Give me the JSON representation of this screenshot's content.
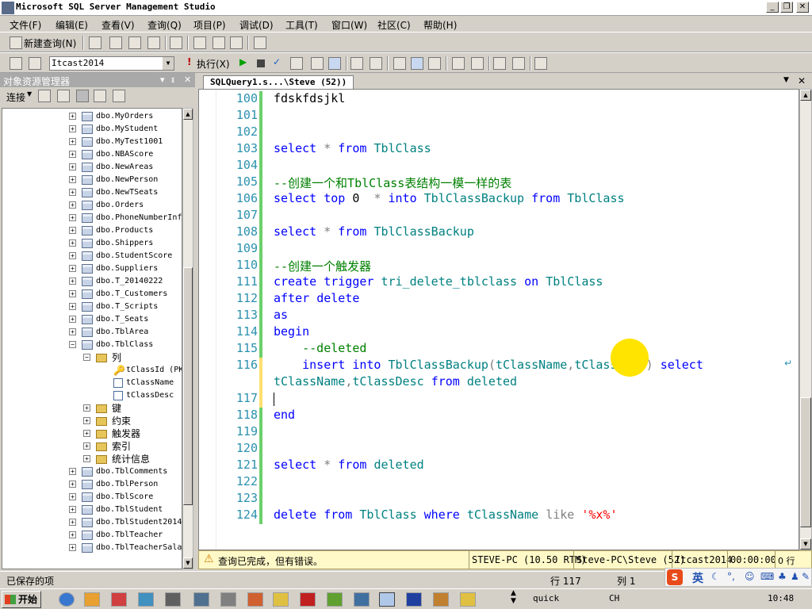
{
  "window": {
    "title": "Microsoft SQL Server Management Studio"
  },
  "menubar": [
    "文件(F)",
    "编辑(E)",
    "查看(V)",
    "查询(Q)",
    "项目(P)",
    "调试(D)",
    "工具(T)",
    "窗口(W)",
    "社区(C)",
    "帮助(H)"
  ],
  "toolbar1": {
    "new_query_label": "新建查询(N)"
  },
  "toolbar2": {
    "database": "Itcast2014",
    "execute_label": "执行(X)"
  },
  "object_explorer": {
    "title": "对象资源管理器",
    "connect_label": "连接",
    "tables": [
      "dbo.MyOrders",
      "dbo.MyStudent",
      "dbo.MyTest1001",
      "dbo.NBAScore",
      "dbo.NewAreas",
      "dbo.NewPerson",
      "dbo.NewTSeats",
      "dbo.Orders",
      "dbo.PhoneNumberInf",
      "dbo.Products",
      "dbo.Shippers",
      "dbo.StudentScore",
      "dbo.Suppliers",
      "dbo.T_20140222",
      "dbo.T_Customers",
      "dbo.T_Scripts",
      "dbo.T_Seats",
      "dbo.TblArea",
      "dbo.TblClass"
    ],
    "folder_columns": "列",
    "columns": [
      "tClassId (PK",
      "tClassName",
      "tClassDesc"
    ],
    "subfolders": [
      "键",
      "约束",
      "触发器",
      "索引",
      "统计信息"
    ],
    "tables_after": [
      "dbo.TblComments",
      "dbo.TblPerson",
      "dbo.TblScore",
      "dbo.TblStudent",
      "dbo.TblStudent2014",
      "dbo.TblTeacher",
      "dbo.TblTeacherSala"
    ]
  },
  "editor": {
    "tab_label": "SQLQuery1.s...\\Steve (52))",
    "lines": [
      {
        "n": "100",
        "tokens": [
          [
            "tx",
            "fdskfdsjkl"
          ]
        ]
      },
      {
        "n": "101",
        "tokens": []
      },
      {
        "n": "102",
        "tokens": []
      },
      {
        "n": "103",
        "tokens": [
          [
            "kw",
            "select"
          ],
          [
            "gr",
            " * "
          ],
          [
            "kw",
            "from"
          ],
          [
            "tx",
            " "
          ],
          [
            "ob",
            "TblClass"
          ]
        ]
      },
      {
        "n": "104",
        "tokens": []
      },
      {
        "n": "105",
        "tokens": [
          [
            "cm",
            "--创建一个和TblClass表结构一模一样的表"
          ]
        ]
      },
      {
        "n": "106",
        "tokens": [
          [
            "kw",
            "select"
          ],
          [
            "tx",
            " "
          ],
          [
            "kw",
            "top"
          ],
          [
            "tx",
            " 0  "
          ],
          [
            "gr",
            "*"
          ],
          [
            "tx",
            " "
          ],
          [
            "kw",
            "into"
          ],
          [
            "tx",
            " "
          ],
          [
            "ob",
            "TblClassBackup"
          ],
          [
            "tx",
            " "
          ],
          [
            "kw",
            "from"
          ],
          [
            "tx",
            " "
          ],
          [
            "ob",
            "TblClass"
          ]
        ]
      },
      {
        "n": "107",
        "tokens": []
      },
      {
        "n": "108",
        "tokens": [
          [
            "kw",
            "select"
          ],
          [
            "gr",
            " * "
          ],
          [
            "kw",
            "from"
          ],
          [
            "tx",
            " "
          ],
          [
            "ob",
            "TblClassBackup"
          ]
        ]
      },
      {
        "n": "109",
        "tokens": []
      },
      {
        "n": "110",
        "tokens": [
          [
            "cm",
            "--创建一个触发器"
          ]
        ]
      },
      {
        "n": "111",
        "tokens": [
          [
            "kw",
            "create"
          ],
          [
            "tx",
            " "
          ],
          [
            "kw",
            "trigger"
          ],
          [
            "tx",
            " "
          ],
          [
            "ob",
            "tri_delete_tblclass"
          ],
          [
            "tx",
            " "
          ],
          [
            "kw",
            "on"
          ],
          [
            "tx",
            " "
          ],
          [
            "ob",
            "TblClass"
          ]
        ]
      },
      {
        "n": "112",
        "tokens": [
          [
            "kw",
            "after"
          ],
          [
            "tx",
            " "
          ],
          [
            "kw",
            "delete"
          ]
        ]
      },
      {
        "n": "113",
        "tokens": [
          [
            "kw",
            "as"
          ]
        ]
      },
      {
        "n": "114",
        "tokens": [
          [
            "kw",
            "begin"
          ]
        ]
      },
      {
        "n": "115",
        "tokens": [
          [
            "tx",
            "    "
          ],
          [
            "cm",
            "--deleted"
          ]
        ]
      },
      {
        "n": "116",
        "tokens": [
          [
            "tx",
            "    "
          ],
          [
            "kw",
            "insert"
          ],
          [
            "tx",
            " "
          ],
          [
            "kw",
            "into"
          ],
          [
            "tx",
            " "
          ],
          [
            "ob",
            "TblClassBackup"
          ],
          [
            "gr",
            "("
          ],
          [
            "ob",
            "tClassName"
          ],
          [
            "gr",
            ","
          ],
          [
            "ob",
            "tClassdesc"
          ],
          [
            "gr",
            ")"
          ],
          [
            "tx",
            " "
          ],
          [
            "kw",
            "select"
          ]
        ]
      },
      {
        "n": "",
        "tokens": [
          [
            "ob",
            "tClassName"
          ],
          [
            "gr",
            ","
          ],
          [
            "ob",
            "tClassDesc"
          ],
          [
            "tx",
            " "
          ],
          [
            "kw",
            "from"
          ],
          [
            "tx",
            " "
          ],
          [
            "ob",
            "deleted"
          ]
        ]
      },
      {
        "n": "117",
        "tokens": []
      },
      {
        "n": "118",
        "tokens": [
          [
            "kw",
            "end"
          ]
        ]
      },
      {
        "n": "119",
        "tokens": []
      },
      {
        "n": "120",
        "tokens": []
      },
      {
        "n": "121",
        "tokens": [
          [
            "kw",
            "select"
          ],
          [
            "gr",
            " * "
          ],
          [
            "kw",
            "from"
          ],
          [
            "tx",
            " "
          ],
          [
            "ob",
            "deleted"
          ]
        ]
      },
      {
        "n": "122",
        "tokens": []
      },
      {
        "n": "123",
        "tokens": []
      },
      {
        "n": "124",
        "tokens": [
          [
            "kw",
            "delete"
          ],
          [
            "tx",
            " "
          ],
          [
            "kw",
            "from"
          ],
          [
            "tx",
            " "
          ],
          [
            "ob",
            "TblClass"
          ],
          [
            "tx",
            " "
          ],
          [
            "kw",
            "where"
          ],
          [
            "tx",
            " "
          ],
          [
            "ob",
            "tClassName"
          ],
          [
            "tx",
            " "
          ],
          [
            "gr",
            "like"
          ],
          [
            "tx",
            " "
          ],
          [
            "st",
            "'%x%'"
          ]
        ]
      }
    ]
  },
  "query_status": {
    "message": "查询已完成，但有错误。",
    "server": "STEVE-PC (10.50 RTM)",
    "user": "Steve-PC\\Steve (52)",
    "database": "Itcast2014",
    "time": "00:00:00",
    "rows": "0 行"
  },
  "status": {
    "left": "已保存的项",
    "line": "行 117",
    "col": "列 1"
  },
  "ime": {
    "label": "英"
  },
  "taskbar": {
    "start": "开始",
    "quick": "quick",
    "lang": "CH",
    "clock": "10:48"
  }
}
